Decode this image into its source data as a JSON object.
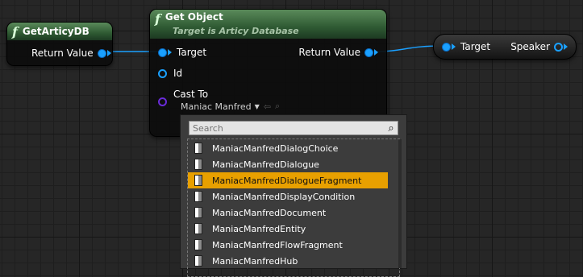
{
  "nodes": {
    "get_articy_db": {
      "title": "GetArticyDB",
      "output_label": "Return Value"
    },
    "get_object": {
      "title": "Get Object",
      "subtitle": "Target is Articy Database",
      "inputs": [
        "Target",
        "Id",
        "Cast To"
      ],
      "output_label": "Return Value",
      "cast_value": "Maniac Manfred"
    },
    "speaker": {
      "input_label": "Target",
      "output_label": "Speaker"
    }
  },
  "picker": {
    "search_placeholder": "Search",
    "items": [
      "ManiacManfredDialogChoice",
      "ManiacManfredDialogue",
      "ManiacManfredDialogueFragment",
      "ManiacManfredDisplayCondition",
      "ManiacManfredDocument",
      "ManiacManfredEntity",
      "ManiacManfredFlowFragment",
      "ManiacManfredHub"
    ],
    "selected_index": 2
  },
  "colors": {
    "exec_pin": "#1aa0ff",
    "class_pin": "#6a2bd9",
    "selection": "#e8a000"
  }
}
